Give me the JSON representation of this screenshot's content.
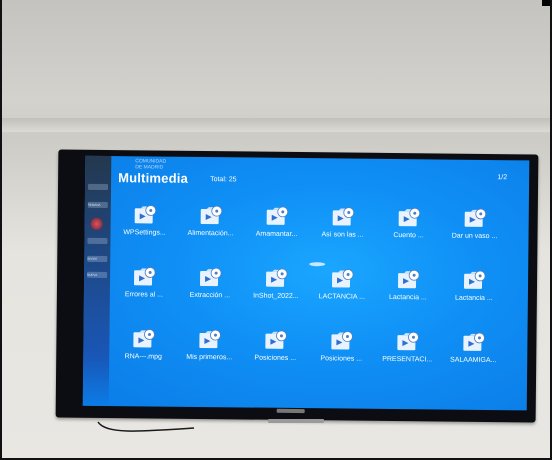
{
  "screen": {
    "title": "Multimedia",
    "total": "Total: 25",
    "page": "1/2",
    "header_badge": [
      "COMUNIDAD",
      "DE MADRID"
    ],
    "sidebar_labels": [
      "SEMANA",
      "SPORT",
      "NUEVA"
    ]
  },
  "files": [
    {
      "label": "WPSettings..."
    },
    {
      "label": "Alimentación..."
    },
    {
      "label": "Amamantar..."
    },
    {
      "label": "Así son las ..."
    },
    {
      "label": "Cuento ..."
    },
    {
      "label": "Dar un vaso ..."
    },
    {
      "label": "Errores al ..."
    },
    {
      "label": "Extracción ..."
    },
    {
      "label": "InShot_2022..."
    },
    {
      "label": "LACTANCIA ..."
    },
    {
      "label": "Lactancia ..."
    },
    {
      "label": "Lactancia ..."
    },
    {
      "label": "RNA---.mpg"
    },
    {
      "label": "Mis primeros..."
    },
    {
      "label": "Posiciones ..."
    },
    {
      "label": "Posiciones ..."
    },
    {
      "label": "PRESENTACI..."
    },
    {
      "label": "SALAAMIGA..."
    }
  ],
  "colors": {
    "screen_blue": "#0f8ff5",
    "bezel": "#0c0d12",
    "wall": "#e6e4df"
  },
  "icons": {
    "file": "video-file-icon"
  }
}
